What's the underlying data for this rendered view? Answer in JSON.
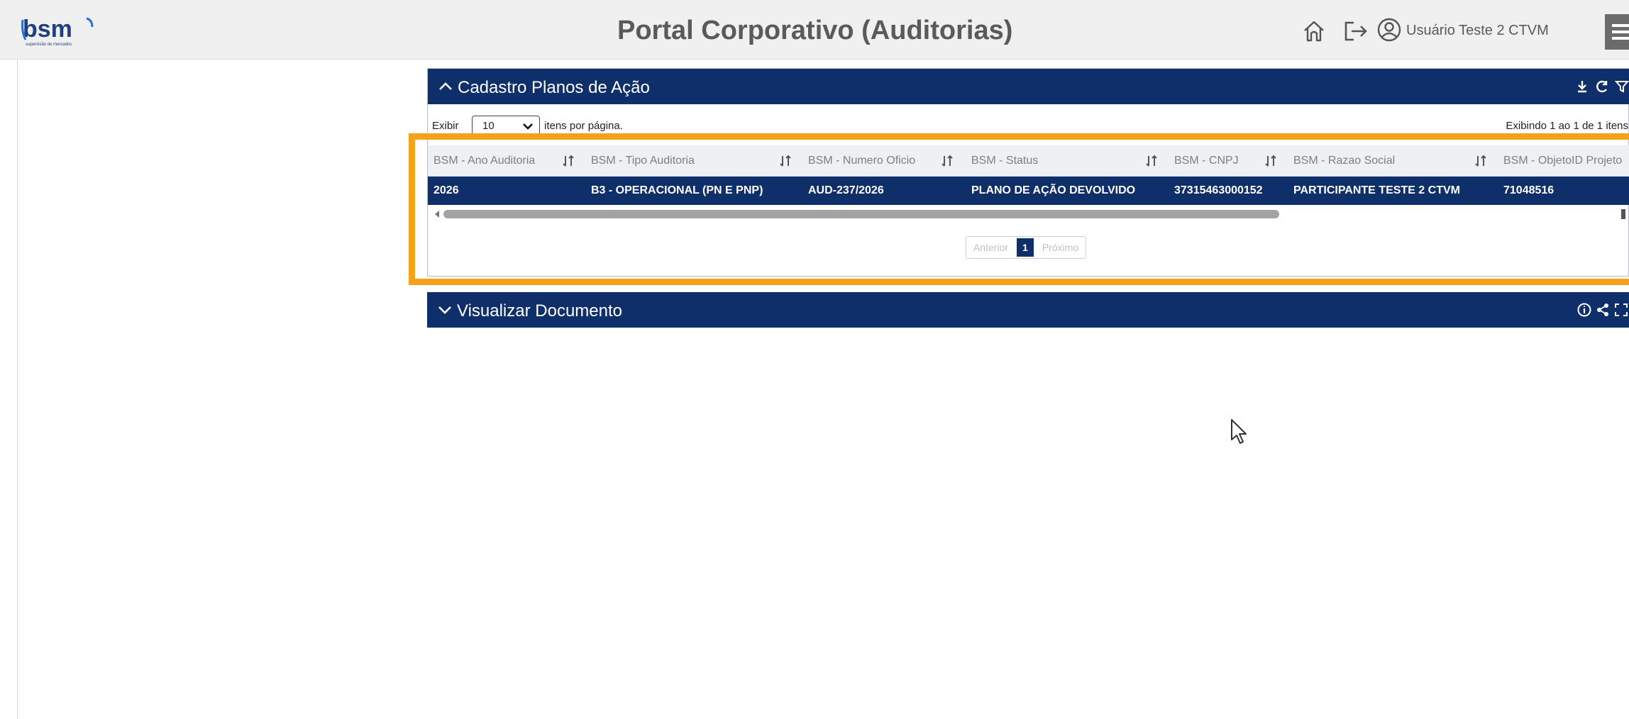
{
  "header": {
    "logo_text": "bsm",
    "logo_tagline": "supervisão de mercados",
    "title": "Portal Corporativo (Auditorias)",
    "user_name": "Usuário Teste 2 CTVM",
    "icons": [
      "home-icon",
      "logout-icon",
      "user-icon",
      "menu-icon"
    ]
  },
  "panel_planos": {
    "title": "Cadastro Planos de Ação",
    "length_label_before": "Exibir",
    "length_value": "10",
    "length_label_after": "itens por página.",
    "info": "Exibindo 1 ao 1 de 1 itens",
    "columns": [
      "BSM - Ano Auditoria",
      "BSM - Tipo Auditoria",
      "BSM - Numero Oficio",
      "BSM - Status",
      "BSM - CNPJ",
      "BSM - Razao Social",
      "BSM - ObjetoID Projeto"
    ],
    "rows": [
      [
        "2026",
        "B3 - OPERACIONAL (PN E PNP)",
        "AUD-237/2026",
        "PLANO DE AÇÃO DEVOLVIDO",
        "37315463000152",
        "PARTICIPANTE TESTE 2 CTVM",
        "71048516"
      ]
    ],
    "pagination": {
      "previous": "Anterior",
      "current": "1",
      "next": "Próximo"
    }
  },
  "panel_documento": {
    "title": "Visualizar Documento"
  },
  "colors": {
    "panel_header": "#0f2f6a",
    "highlight": "#f5a11b",
    "brand": "#1f3f80"
  }
}
